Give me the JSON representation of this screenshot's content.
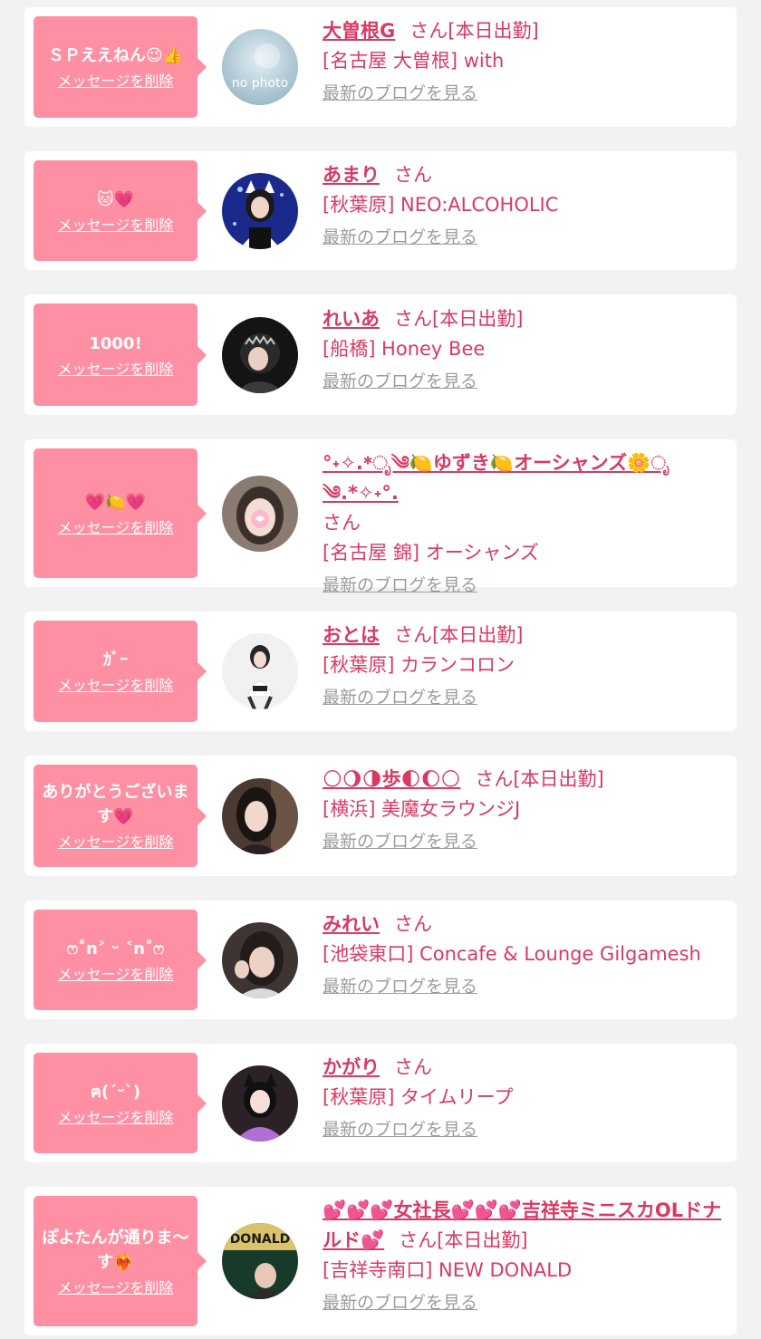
{
  "delete_label": "メッセージを削除",
  "blog_label": "最新のブログを見る",
  "honorific": "さん",
  "colors": {
    "accent": "#d83a63",
    "bubble": "#ff8fa3",
    "link_gray": "#9c9c9c",
    "background": "#f2f2f2"
  },
  "items": [
    {
      "message": "ＳＰええねん😉👍",
      "name": "大曽根G",
      "status": "[本日出勤]",
      "shop": "[名古屋 大曽根] with",
      "avatar_text": "no photo"
    },
    {
      "message": "🐱💗",
      "name": "あまり",
      "status": "",
      "shop": "[秋葉原] NEO:ALCOHOLIC"
    },
    {
      "message": "1000!",
      "name": "れいあ",
      "status": "[本日出勤]",
      "shop": "[船橋] Honey Bee"
    },
    {
      "message": "💗🍋💗",
      "name": "°˖✧.*ೃ༄🍋ゆずき🍋オーシャンズ🌼ೃ༄.*✧˖°.",
      "status": "",
      "shop": "[名古屋 錦] オーシャンズ"
    },
    {
      "message": "ｶﾞｰ",
      "name": "おとは",
      "status": "[本日出勤]",
      "shop": "[秋葉原] カランコロン"
    },
    {
      "message": "ありがとうございます💗",
      "name": "🌕🌖🌗歩🌓🌔🌕",
      "status": "[本日出勤]",
      "shop": "[横浜] 美魔女ラウンジJ"
    },
    {
      "message": "ෆ˚n˃ ᵕ ˂n˚ෆ",
      "name": "みれい",
      "status": "",
      "shop": "[池袋東口] Concafe & Lounge Gilgamesh"
    },
    {
      "message": "ฅ(ˊᵕˋ)",
      "name": "かがり",
      "status": "",
      "shop": "[秋葉原] タイムリープ"
    },
    {
      "message": "ぽよたんが通りま〜す❤️‍🔥",
      "name": "💕💕💕女社長💕💕💕吉祥寺ミニスカOLドナルド💕",
      "status": "[本日出勤]",
      "shop": "[吉祥寺南口] NEW DONALD",
      "avatar_text": "DONALD"
    }
  ]
}
